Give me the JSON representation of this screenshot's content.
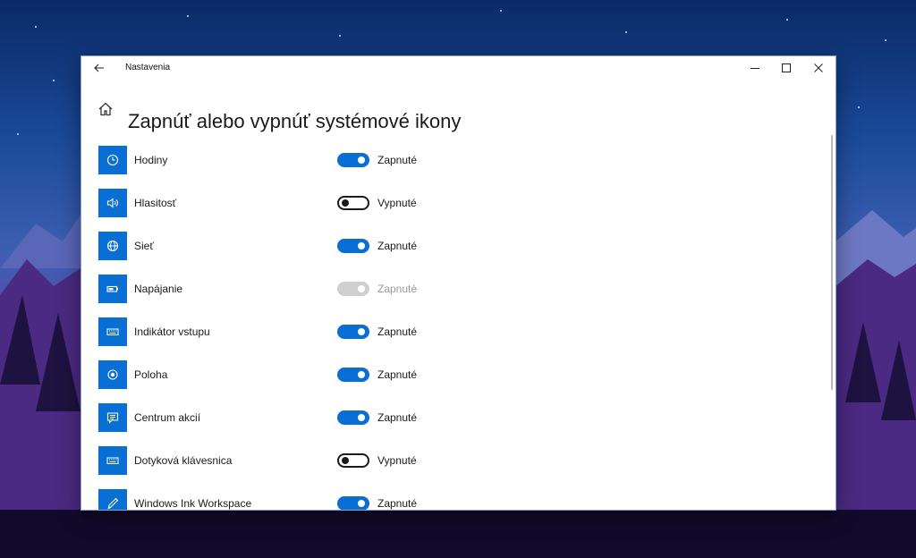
{
  "window": {
    "app_title": "Nastavenia",
    "controls": {
      "minimize": "minimize-icon",
      "maximize": "maximize-icon",
      "close": "close-icon"
    }
  },
  "header": {
    "title": "Zapnúť alebo vypnúť systémové ikony"
  },
  "colors": {
    "accent": "#0a6fd4",
    "disabled": "#cfcfcf"
  },
  "items": [
    {
      "label": "Hodiny",
      "state": "Zapnuté",
      "on": true,
      "disabled": false,
      "icon": "clock-icon"
    },
    {
      "label": "Hlasitosť",
      "state": "Vypnuté",
      "on": false,
      "disabled": false,
      "icon": "volume-icon"
    },
    {
      "label": "Sieť",
      "state": "Zapnuté",
      "on": true,
      "disabled": false,
      "icon": "globe-icon"
    },
    {
      "label": "Napájanie",
      "state": "Zapnuté",
      "on": true,
      "disabled": true,
      "icon": "battery-icon"
    },
    {
      "label": "Indikátor vstupu",
      "state": "Zapnuté",
      "on": true,
      "disabled": false,
      "icon": "keyboard-icon"
    },
    {
      "label": "Poloha",
      "state": "Zapnuté",
      "on": true,
      "disabled": false,
      "icon": "location-icon"
    },
    {
      "label": "Centrum akcií",
      "state": "Zapnuté",
      "on": true,
      "disabled": false,
      "icon": "action-center-icon"
    },
    {
      "label": "Dotyková klávesnica",
      "state": "Vypnuté",
      "on": false,
      "disabled": false,
      "icon": "touch-keyboard-icon"
    },
    {
      "label": "Windows Ink Workspace",
      "state": "Zapnuté",
      "on": true,
      "disabled": false,
      "icon": "pen-icon"
    }
  ]
}
